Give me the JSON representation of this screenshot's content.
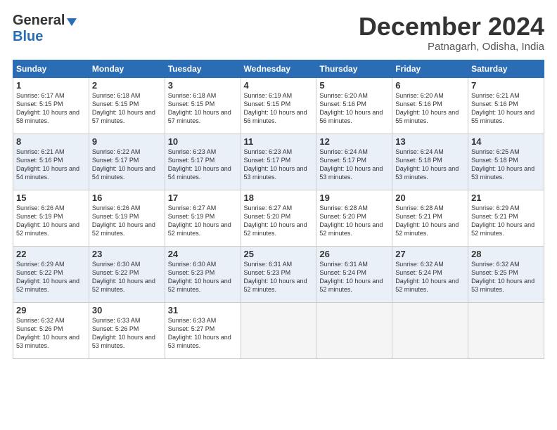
{
  "header": {
    "logo_line1": "General",
    "logo_line2": "Blue",
    "month_title": "December 2024",
    "subtitle": "Patnagarh, Odisha, India"
  },
  "days_of_week": [
    "Sunday",
    "Monday",
    "Tuesday",
    "Wednesday",
    "Thursday",
    "Friday",
    "Saturday"
  ],
  "weeks": [
    [
      {
        "num": "1",
        "sunrise": "Sunrise: 6:17 AM",
        "sunset": "Sunset: 5:15 PM",
        "daylight": "Daylight: 10 hours and 58 minutes."
      },
      {
        "num": "2",
        "sunrise": "Sunrise: 6:18 AM",
        "sunset": "Sunset: 5:15 PM",
        "daylight": "Daylight: 10 hours and 57 minutes."
      },
      {
        "num": "3",
        "sunrise": "Sunrise: 6:18 AM",
        "sunset": "Sunset: 5:15 PM",
        "daylight": "Daylight: 10 hours and 57 minutes."
      },
      {
        "num": "4",
        "sunrise": "Sunrise: 6:19 AM",
        "sunset": "Sunset: 5:15 PM",
        "daylight": "Daylight: 10 hours and 56 minutes."
      },
      {
        "num": "5",
        "sunrise": "Sunrise: 6:20 AM",
        "sunset": "Sunset: 5:16 PM",
        "daylight": "Daylight: 10 hours and 56 minutes."
      },
      {
        "num": "6",
        "sunrise": "Sunrise: 6:20 AM",
        "sunset": "Sunset: 5:16 PM",
        "daylight": "Daylight: 10 hours and 55 minutes."
      },
      {
        "num": "7",
        "sunrise": "Sunrise: 6:21 AM",
        "sunset": "Sunset: 5:16 PM",
        "daylight": "Daylight: 10 hours and 55 minutes."
      }
    ],
    [
      {
        "num": "8",
        "sunrise": "Sunrise: 6:21 AM",
        "sunset": "Sunset: 5:16 PM",
        "daylight": "Daylight: 10 hours and 54 minutes."
      },
      {
        "num": "9",
        "sunrise": "Sunrise: 6:22 AM",
        "sunset": "Sunset: 5:17 PM",
        "daylight": "Daylight: 10 hours and 54 minutes."
      },
      {
        "num": "10",
        "sunrise": "Sunrise: 6:23 AM",
        "sunset": "Sunset: 5:17 PM",
        "daylight": "Daylight: 10 hours and 54 minutes."
      },
      {
        "num": "11",
        "sunrise": "Sunrise: 6:23 AM",
        "sunset": "Sunset: 5:17 PM",
        "daylight": "Daylight: 10 hours and 53 minutes."
      },
      {
        "num": "12",
        "sunrise": "Sunrise: 6:24 AM",
        "sunset": "Sunset: 5:17 PM",
        "daylight": "Daylight: 10 hours and 53 minutes."
      },
      {
        "num": "13",
        "sunrise": "Sunrise: 6:24 AM",
        "sunset": "Sunset: 5:18 PM",
        "daylight": "Daylight: 10 hours and 53 minutes."
      },
      {
        "num": "14",
        "sunrise": "Sunrise: 6:25 AM",
        "sunset": "Sunset: 5:18 PM",
        "daylight": "Daylight: 10 hours and 53 minutes."
      }
    ],
    [
      {
        "num": "15",
        "sunrise": "Sunrise: 6:26 AM",
        "sunset": "Sunset: 5:19 PM",
        "daylight": "Daylight: 10 hours and 52 minutes."
      },
      {
        "num": "16",
        "sunrise": "Sunrise: 6:26 AM",
        "sunset": "Sunset: 5:19 PM",
        "daylight": "Daylight: 10 hours and 52 minutes."
      },
      {
        "num": "17",
        "sunrise": "Sunrise: 6:27 AM",
        "sunset": "Sunset: 5:19 PM",
        "daylight": "Daylight: 10 hours and 52 minutes."
      },
      {
        "num": "18",
        "sunrise": "Sunrise: 6:27 AM",
        "sunset": "Sunset: 5:20 PM",
        "daylight": "Daylight: 10 hours and 52 minutes."
      },
      {
        "num": "19",
        "sunrise": "Sunrise: 6:28 AM",
        "sunset": "Sunset: 5:20 PM",
        "daylight": "Daylight: 10 hours and 52 minutes."
      },
      {
        "num": "20",
        "sunrise": "Sunrise: 6:28 AM",
        "sunset": "Sunset: 5:21 PM",
        "daylight": "Daylight: 10 hours and 52 minutes."
      },
      {
        "num": "21",
        "sunrise": "Sunrise: 6:29 AM",
        "sunset": "Sunset: 5:21 PM",
        "daylight": "Daylight: 10 hours and 52 minutes."
      }
    ],
    [
      {
        "num": "22",
        "sunrise": "Sunrise: 6:29 AM",
        "sunset": "Sunset: 5:22 PM",
        "daylight": "Daylight: 10 hours and 52 minutes."
      },
      {
        "num": "23",
        "sunrise": "Sunrise: 6:30 AM",
        "sunset": "Sunset: 5:22 PM",
        "daylight": "Daylight: 10 hours and 52 minutes."
      },
      {
        "num": "24",
        "sunrise": "Sunrise: 6:30 AM",
        "sunset": "Sunset: 5:23 PM",
        "daylight": "Daylight: 10 hours and 52 minutes."
      },
      {
        "num": "25",
        "sunrise": "Sunrise: 6:31 AM",
        "sunset": "Sunset: 5:23 PM",
        "daylight": "Daylight: 10 hours and 52 minutes."
      },
      {
        "num": "26",
        "sunrise": "Sunrise: 6:31 AM",
        "sunset": "Sunset: 5:24 PM",
        "daylight": "Daylight: 10 hours and 52 minutes."
      },
      {
        "num": "27",
        "sunrise": "Sunrise: 6:32 AM",
        "sunset": "Sunset: 5:24 PM",
        "daylight": "Daylight: 10 hours and 52 minutes."
      },
      {
        "num": "28",
        "sunrise": "Sunrise: 6:32 AM",
        "sunset": "Sunset: 5:25 PM",
        "daylight": "Daylight: 10 hours and 53 minutes."
      }
    ],
    [
      {
        "num": "29",
        "sunrise": "Sunrise: 6:32 AM",
        "sunset": "Sunset: 5:26 PM",
        "daylight": "Daylight: 10 hours and 53 minutes."
      },
      {
        "num": "30",
        "sunrise": "Sunrise: 6:33 AM",
        "sunset": "Sunset: 5:26 PM",
        "daylight": "Daylight: 10 hours and 53 minutes."
      },
      {
        "num": "31",
        "sunrise": "Sunrise: 6:33 AM",
        "sunset": "Sunset: 5:27 PM",
        "daylight": "Daylight: 10 hours and 53 minutes."
      },
      null,
      null,
      null,
      null
    ]
  ]
}
